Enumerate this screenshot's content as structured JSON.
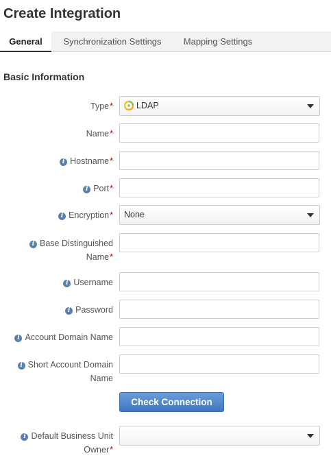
{
  "page": {
    "title": "Create Integration"
  },
  "tabs": [
    {
      "label": "General",
      "active": true
    },
    {
      "label": "Synchronization Settings",
      "active": false
    },
    {
      "label": "Mapping Settings",
      "active": false
    }
  ],
  "section": {
    "title": "Basic Information"
  },
  "fields": {
    "type": {
      "label": "Type",
      "value": "LDAP",
      "icon": "ldap-icon"
    },
    "name": {
      "label": "Name",
      "value": ""
    },
    "hostname": {
      "label": "Hostname",
      "value": ""
    },
    "port": {
      "label": "Port",
      "value": ""
    },
    "encryption": {
      "label": "Encryption",
      "value": "None"
    },
    "base_dn": {
      "label_line1": "Base Distinguished",
      "label_line2": "Name",
      "value": ""
    },
    "username": {
      "label": "Username",
      "value": ""
    },
    "password": {
      "label": "Password",
      "value": ""
    },
    "account_domain": {
      "label": "Account Domain Name",
      "value": ""
    },
    "short_account_domain": {
      "label_line1": "Short Account Domain",
      "label_line2": "Name",
      "value": ""
    },
    "default_bu_owner": {
      "label_line1": "Default Business Unit",
      "label_line2": "Owner",
      "value": ""
    }
  },
  "buttons": {
    "check_connection": "Check Connection"
  },
  "markers": {
    "required": "*",
    "info": "i"
  },
  "colors": {
    "accent": "#4a80c8",
    "required": "#cc0000",
    "info": "#5b7fae"
  }
}
